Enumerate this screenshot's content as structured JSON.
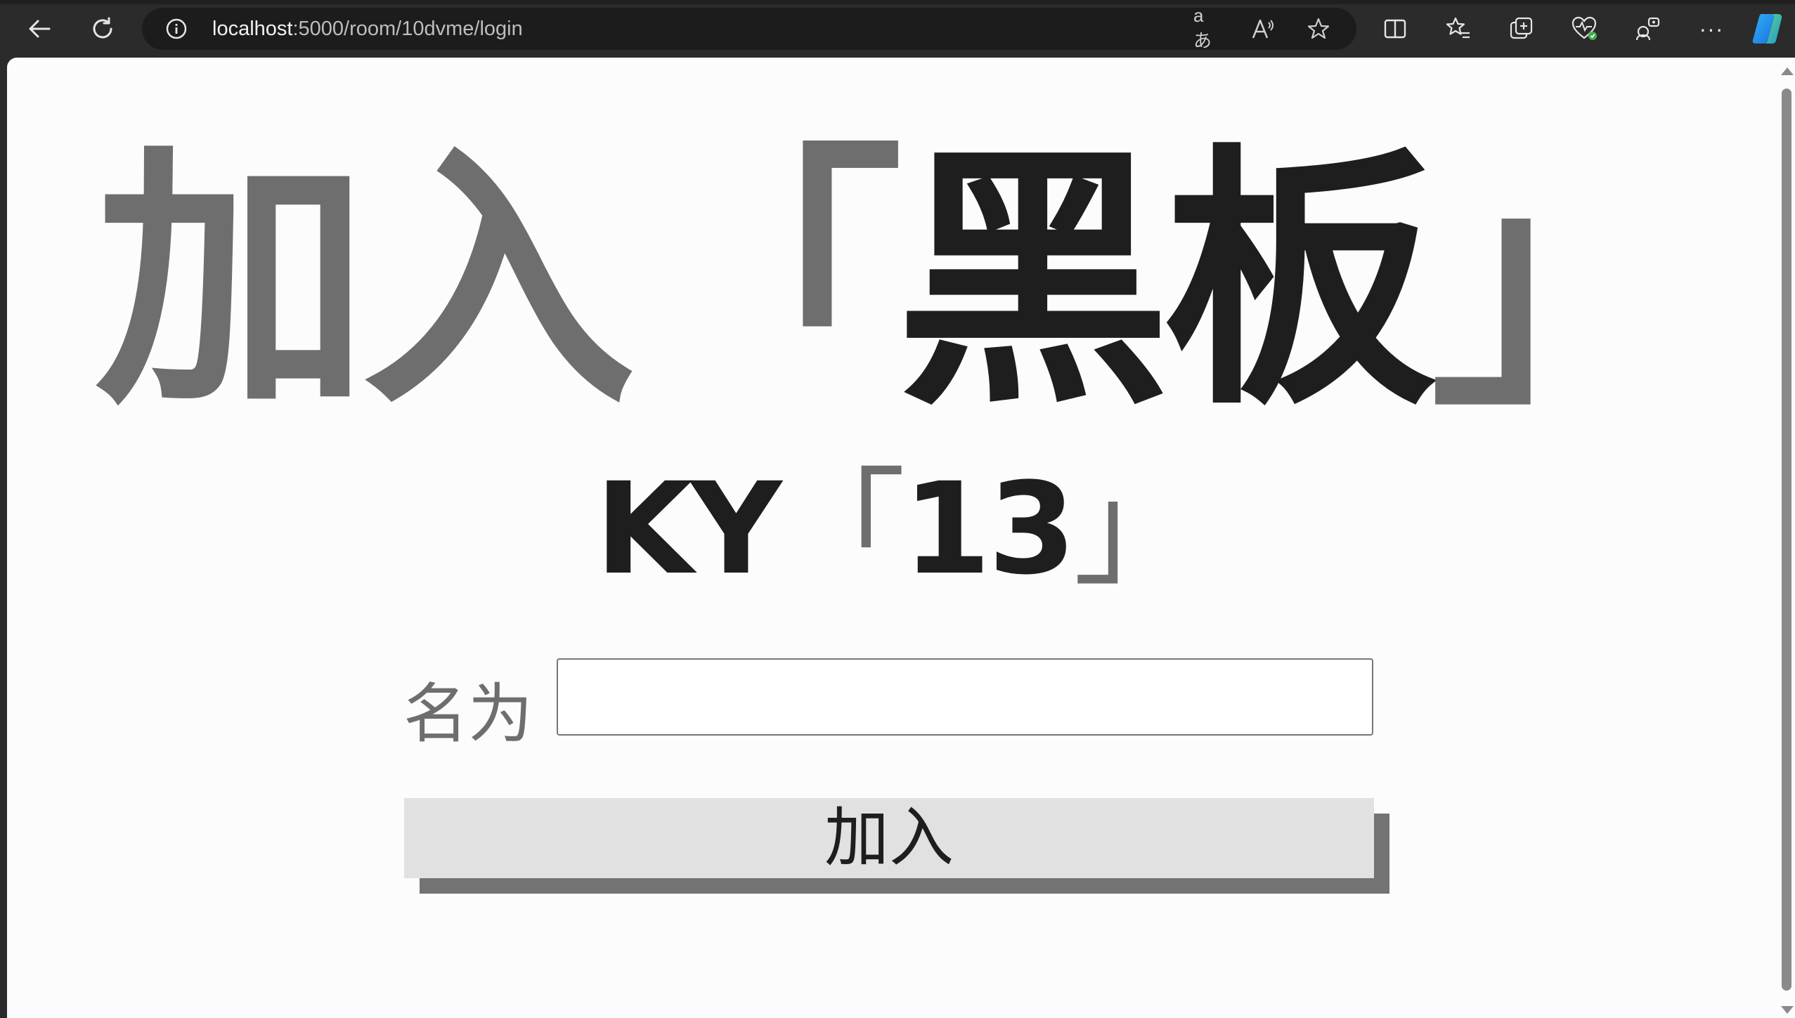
{
  "browser": {
    "url_host": "localhost",
    "url_path": ":5000/room/10dvme/login",
    "icons": {
      "back": "back-arrow-icon",
      "refresh": "refresh-icon",
      "site_info": "info-icon",
      "read_aloud_translate": "translate-icon",
      "read_aloud": "read-aloud-icon",
      "favorite": "star-icon",
      "split_screen": "split-screen-icon",
      "favorites": "favorites-icon",
      "collections": "collections-icon",
      "browser_essentials": "heart-pulse-icon",
      "extensions": "extensions-icon",
      "more": "more-icon",
      "copilot": "copilot-icon"
    },
    "translate_glyph": "aあ",
    "more_glyph": "···"
  },
  "page": {
    "title_prefix": "加入",
    "title_bracket_open": "「",
    "title_main": "黑板",
    "title_bracket_close": "」",
    "subtitle_prefix": "KY",
    "subtitle_bracket_open": "「",
    "subtitle_number": "13",
    "subtitle_bracket_close": "」"
  },
  "form": {
    "name_label": "名为",
    "name_value": "",
    "join_label": "加入"
  },
  "colors": {
    "grey_text": "#6e6e6e",
    "dark_text": "#1e1e1e",
    "button_bg": "#e1e1e1",
    "button_shadow": "#737373",
    "page_bg": "#fcfcfc"
  }
}
